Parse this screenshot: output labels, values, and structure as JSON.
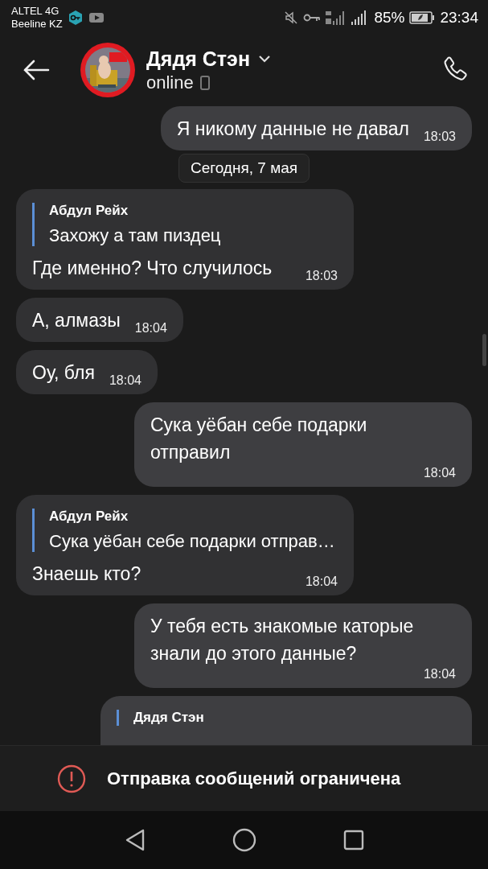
{
  "status_bar": {
    "carriers": [
      "ALTEL 4G",
      "Beeline KZ"
    ],
    "battery": "85%",
    "time": "23:34"
  },
  "header": {
    "name": "Дядя Стэн",
    "status": "online"
  },
  "date_chip": "Сегодня, 7 мая",
  "messages": [
    {
      "kind": "text",
      "outgoing": true,
      "text": "Я никому данные не давал",
      "time": "18:03"
    },
    {
      "kind": "reply",
      "outgoing": false,
      "reply_author": "Абдул Рейх",
      "reply_text": "Захожу а там пиздец",
      "text": "Где именно? Что случилось",
      "time": "18:03"
    },
    {
      "kind": "text",
      "outgoing": false,
      "text": "А, алмазы",
      "time": "18:04"
    },
    {
      "kind": "text",
      "outgoing": false,
      "text": "Оу, бля",
      "time": "18:04"
    },
    {
      "kind": "text",
      "outgoing": true,
      "text": "Сука уёбан себе подарки отправил",
      "time": "18:04"
    },
    {
      "kind": "reply",
      "outgoing": false,
      "reply_author": "Абдул Рейх",
      "reply_text": "Сука уёбан себе подарки отправ…",
      "text": "Знаешь кто?",
      "time": "18:04"
    },
    {
      "kind": "text",
      "outgoing": true,
      "text": "У тебя есть знакомые каторые знали до этого данные?",
      "time": "18:04"
    },
    {
      "kind": "reply",
      "outgoing": true,
      "reply_author": "Дядя Стэн"
    }
  ],
  "notice": "Отправка сообщений ограничена"
}
